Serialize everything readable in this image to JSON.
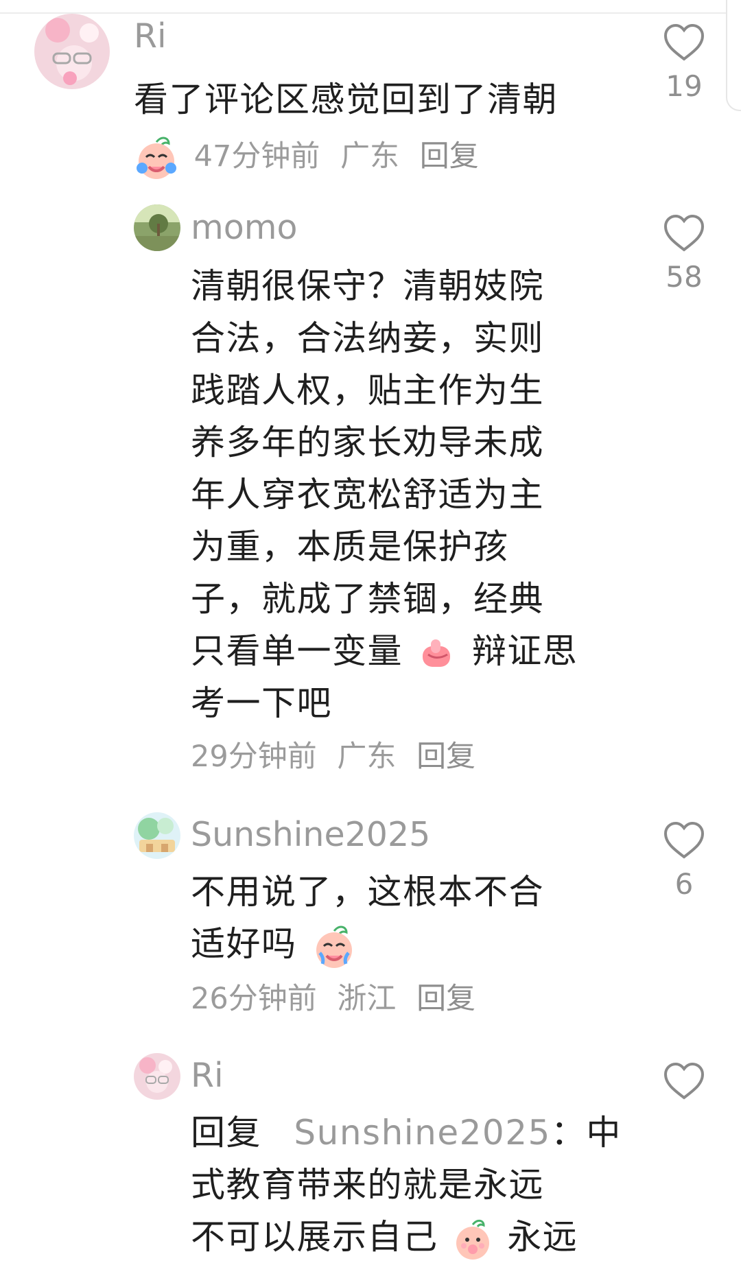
{
  "comments": [
    {
      "user": "Ri",
      "text": "看了评论区感觉回到了清朝",
      "time": "47分钟前",
      "location": "广东",
      "reply": "回复",
      "likes": "19"
    },
    {
      "user": "momo",
      "lines": [
        "清朝很保守？清朝妓院",
        "合法，合法纳妾，实则",
        "践踏人权，贴主作为生",
        "养多年的家长劝导未成",
        "年人穿衣宽松舒适为主",
        "为重，本质是保护孩",
        "子，就成了禁锢，经典",
        "只看单一变量",
        "辩证思",
        "考一下吧"
      ],
      "time": "29分钟前",
      "location": "广东",
      "reply": "回复",
      "likes": "58"
    },
    {
      "user": "Sunshine2025",
      "lines": [
        "不用说了，这根本不合",
        "适好吗"
      ],
      "time": "26分钟前",
      "location": "浙江",
      "reply": "回复",
      "likes": "6"
    },
    {
      "user": "Ri",
      "reply_prefix": "回复",
      "reply_to": "Sunshine2025",
      "lines": [
        "：中",
        "式教育带来的就是永远",
        "不可以展示自己",
        "永远"
      ],
      "likes": ""
    }
  ],
  "icons": {
    "like": "heart-outline-icon",
    "emoji_crying": "crying-emoji",
    "emoji_thumb": "thumbs-up-emoji",
    "emoji_shy": "shy-emoji"
  },
  "colors": {
    "username": "#9a9a9a",
    "text": "#1f1f1f",
    "meta": "#9b9b9b",
    "heart": "#8a8a8a"
  }
}
